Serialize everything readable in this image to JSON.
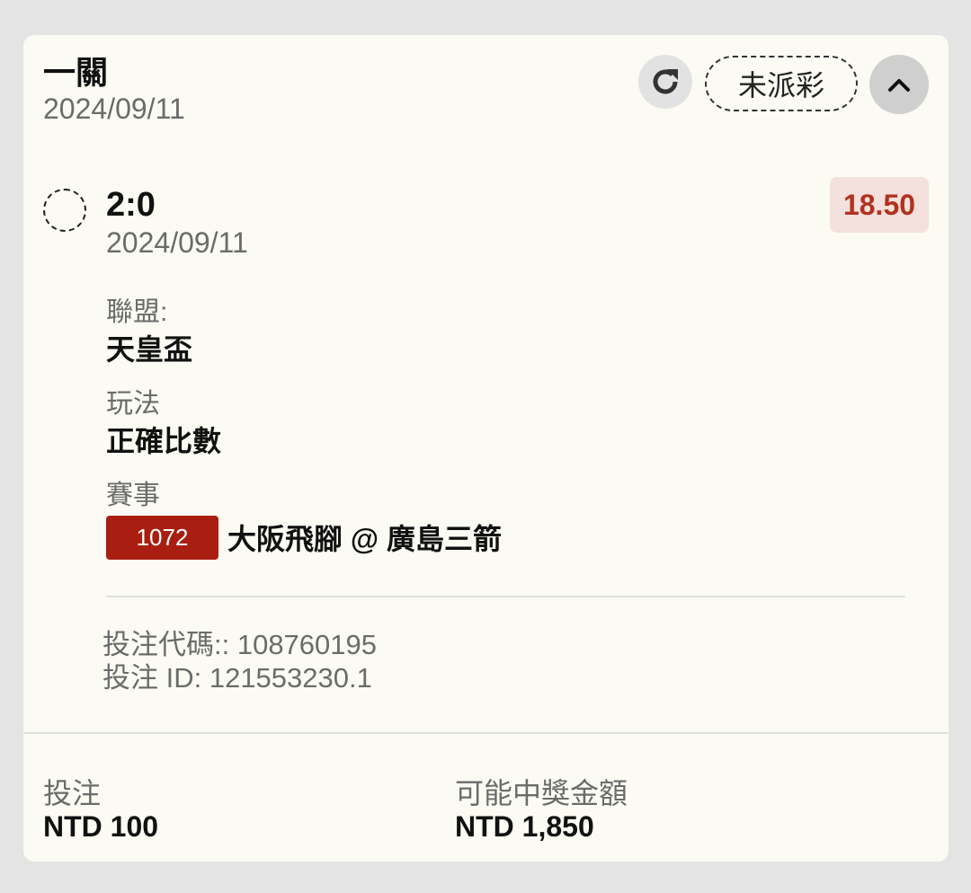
{
  "header": {
    "bet_type": "一關",
    "date": "2024/09/11",
    "status": "未派彩"
  },
  "selection": {
    "score": "2:0",
    "date": "2024/09/11",
    "odds": "18.50"
  },
  "details": {
    "league_label": "聯盟:",
    "league_value": "天皇盃",
    "play_label": "玩法",
    "play_value": "正確比數",
    "match_label": "賽事",
    "match_id": "1072",
    "match_name": "大阪飛腳 @ 廣島三箭"
  },
  "codes": {
    "bet_code": "投注代碼:: 108760195",
    "bet_id": "投注 ID: 121553230.1"
  },
  "footer": {
    "stake_label": "投注",
    "stake_value": "NTD 100",
    "payout_label": "可能中獎金額",
    "payout_value": "NTD 1,850"
  },
  "icons": {
    "refresh": "refresh-icon",
    "collapse": "chevron-up-icon"
  },
  "colors": {
    "odds_text": "#b0321f",
    "odds_bg": "#f4e0dc",
    "match_badge": "#a81f12",
    "card_bg": "#fbfbf3"
  }
}
